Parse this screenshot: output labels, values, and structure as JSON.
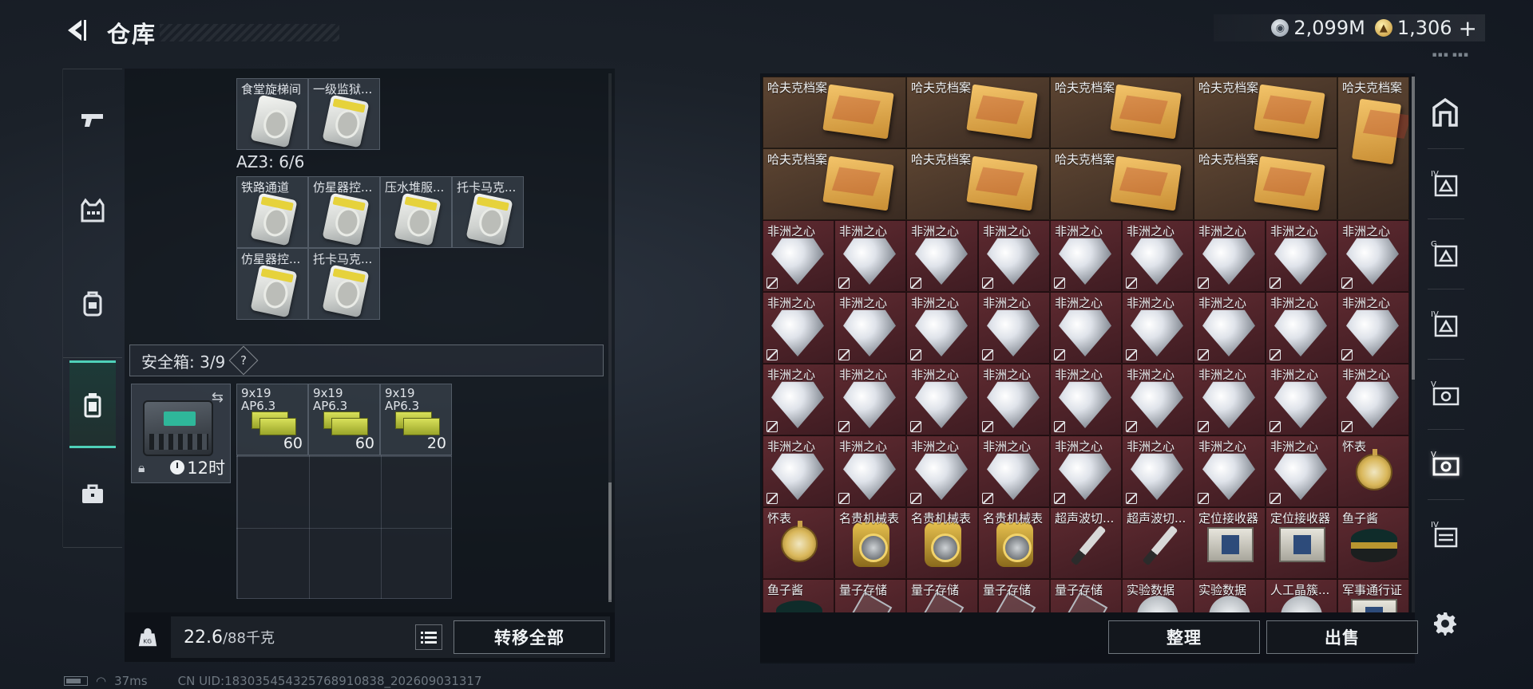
{
  "header": {
    "title": "仓库"
  },
  "currency": {
    "silver": {
      "icon": "silver-coin-icon",
      "value": "2,099M"
    },
    "gold": {
      "icon": "gold-coin-icon",
      "value": "1,306"
    },
    "plus": "+"
  },
  "left_nav": {
    "items": [
      {
        "name": "weapons",
        "icon": "pistol-icon"
      },
      {
        "name": "armor",
        "icon": "vest-icon"
      },
      {
        "name": "backpack",
        "icon": "backpack-icon"
      },
      {
        "name": "container",
        "icon": "canister-icon",
        "active": true
      },
      {
        "name": "toolbox",
        "icon": "briefcase-icon"
      }
    ]
  },
  "left_panel": {
    "top_cells": [
      {
        "label": "食堂旋梯间"
      },
      {
        "label": "一级监狱..."
      }
    ],
    "az3_label": "AZ3: 6/6",
    "az3_cells": [
      {
        "label": "铁路通道"
      },
      {
        "label": "仿星器控..."
      },
      {
        "label": "压水堆服..."
      },
      {
        "label": "托卡马克..."
      },
      {
        "label": "仿星器控..."
      },
      {
        "label": "托卡马克..."
      }
    ],
    "safe": {
      "label": "安全箱: 3/9",
      "help": "?",
      "timer": "12时",
      "ammo": [
        {
          "line1": "9x19",
          "line2": "AP6.3",
          "qty": "60"
        },
        {
          "line1": "9x19",
          "line2": "AP6.3",
          "qty": "60"
        },
        {
          "line1": "9x19",
          "line2": "AP6.3",
          "qty": "20"
        }
      ]
    }
  },
  "left_bottom": {
    "weight_value": "22.6",
    "weight_max": "/88千克",
    "transfer_label": "转移全部"
  },
  "status": {
    "ping": "37ms",
    "uid": "CN UID:18303545432576891083​8_202609031317"
  },
  "right_panel": {
    "files_label": "哈夫克档案",
    "diamond_label": "非洲之心",
    "row5_extra": "怀表",
    "row6": [
      "怀表",
      "名贵机械表",
      "名贵机械表",
      "名贵机械表",
      "超声波切...",
      "超声波切...",
      "定位接收器",
      "定位接收器",
      "鱼子酱"
    ],
    "row7": [
      "鱼子酱",
      "量子存储",
      "量子存储",
      "量子存储",
      "量子存储",
      "实验数据",
      "实验数据",
      "人工晶簇...",
      "军事通行证"
    ]
  },
  "right_bottom": {
    "sort_label": "整理",
    "sell_label": "出售"
  },
  "right_nav": {
    "items": [
      {
        "icon": "storage-icon"
      },
      {
        "icon": "vault-iv-icon"
      },
      {
        "icon": "vault-g-icon"
      },
      {
        "icon": "vault-iv-2-icon"
      },
      {
        "icon": "vault-v-icon"
      },
      {
        "icon": "vault-v-active-icon",
        "active": true
      },
      {
        "icon": "vault-iv-3-icon"
      }
    ]
  }
}
